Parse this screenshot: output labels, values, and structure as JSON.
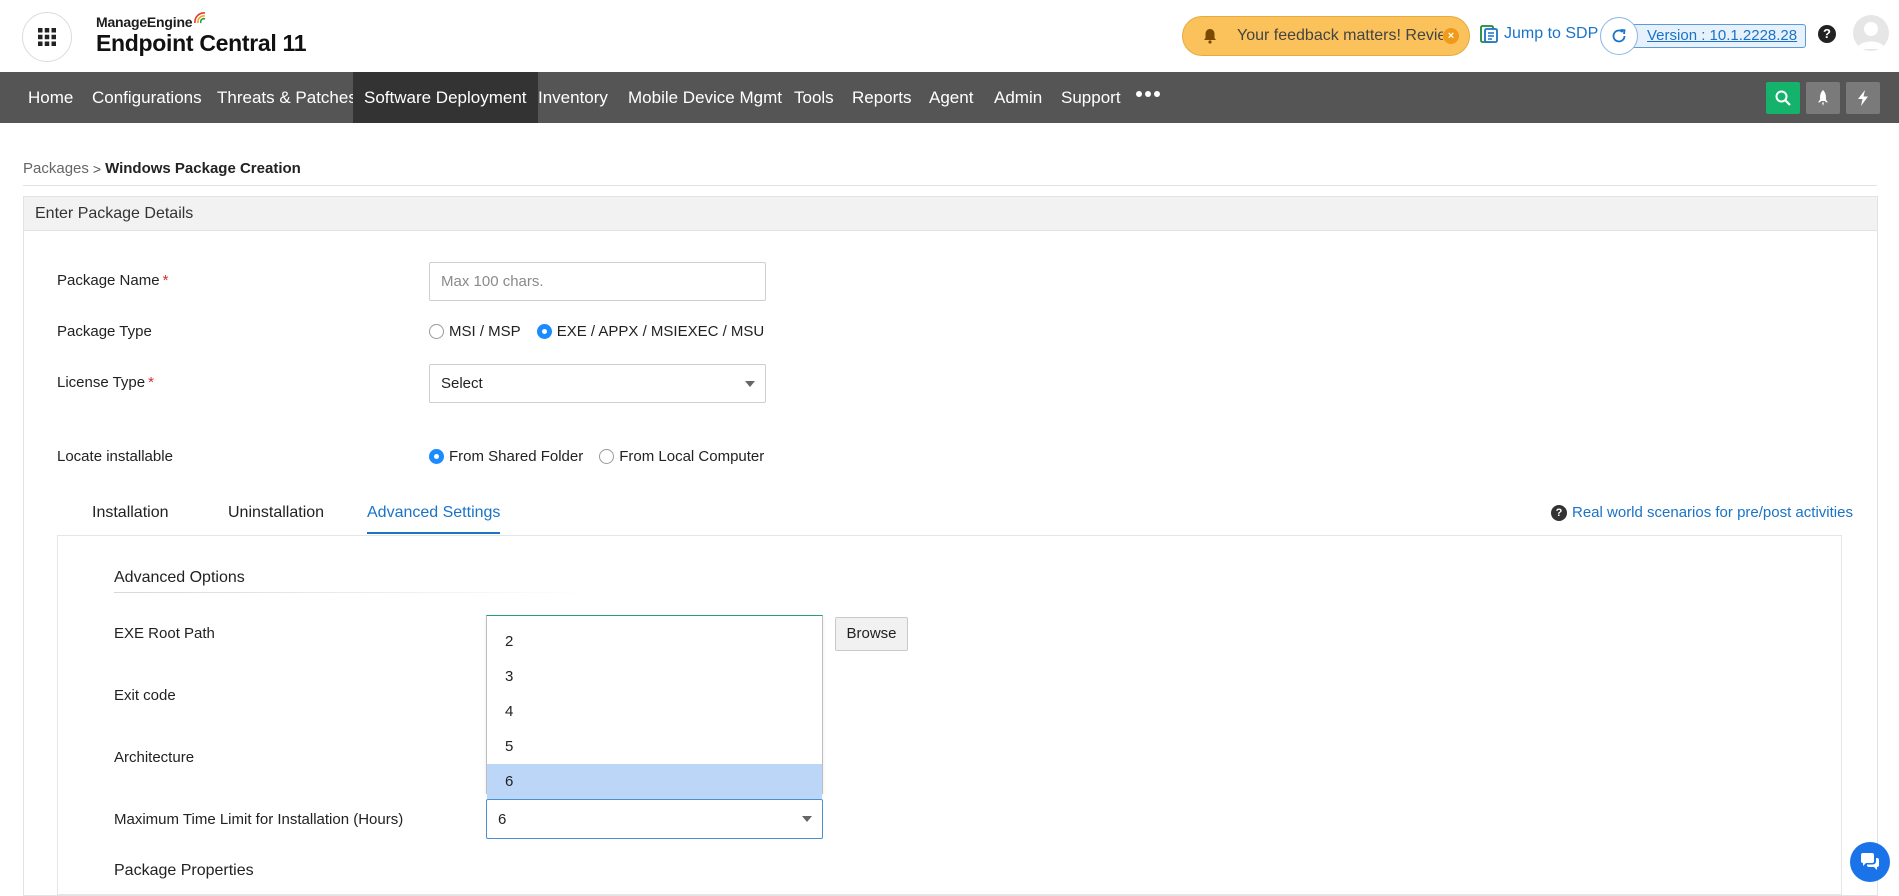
{
  "header": {
    "vendor": "ManageEngine",
    "product": "Endpoint Central 11",
    "feedback_text": "Your feedback matters! Revie...",
    "jump_label": "Jump to SDP",
    "version_label": "Version : 10.1.2228.28",
    "help_glyph": "?"
  },
  "nav": {
    "items": [
      "Home",
      "Configurations",
      "Threats & Patches",
      "Software Deployment",
      "Inventory",
      "Mobile Device Mgmt",
      "Tools",
      "Reports",
      "Agent",
      "Admin",
      "Support"
    ],
    "active": "Software Deployment"
  },
  "breadcrumb": {
    "parent": "Packages",
    "separator": ">",
    "current": "Windows Package Creation"
  },
  "panel": {
    "title": "Enter Package Details"
  },
  "form": {
    "package_name_label": "Package Name",
    "package_name_placeholder": "Max 100 chars.",
    "required_mark": "*",
    "package_type_label": "Package Type",
    "package_type_options": [
      "MSI / MSP",
      "EXE / APPX / MSIEXEC / MSU"
    ],
    "package_type_selected": "EXE / APPX / MSIEXEC / MSU",
    "license_type_label": "License Type",
    "license_type_value": "Select",
    "locate_label": "Locate installable",
    "locate_options": [
      "From Shared Folder",
      "From Local Computer"
    ],
    "locate_selected": "From Shared Folder"
  },
  "tabs": {
    "items": [
      "Installation",
      "Uninstallation",
      "Advanced Settings"
    ],
    "active": "Advanced Settings",
    "help_glyph": "?",
    "scenarios_link": "Real world scenarios for pre/post activities"
  },
  "advanced": {
    "section_title": "Advanced Options",
    "exe_root_label": "EXE Root Path",
    "browse_label": "Browse",
    "exit_code_label": "Exit code",
    "architecture_label": "Architecture",
    "max_time_label": "Maximum Time Limit for Installation (Hours)",
    "max_time_value": "6",
    "dropdown_options": [
      "2",
      "3",
      "4",
      "5",
      "6"
    ],
    "dropdown_selected": "6",
    "package_properties_title": "Package Properties"
  },
  "colors": {
    "nav_bg": "#555555",
    "nav_active": "#333333",
    "link_blue": "#1a73c7",
    "feedback_bg": "#fbc25b",
    "search_green": "#15b26c",
    "option_highlight": "#bcd6f7"
  },
  "icons": {
    "app_grid": "grid-icon",
    "feedback": "bell-icon",
    "jump": "sdp-icon",
    "refresh": "refresh-icon",
    "help": "help-icon",
    "avatar": "user-avatar",
    "search": "search-icon",
    "rocket": "rocket-icon",
    "bolt": "bolt-icon",
    "chat": "chat-icon"
  }
}
